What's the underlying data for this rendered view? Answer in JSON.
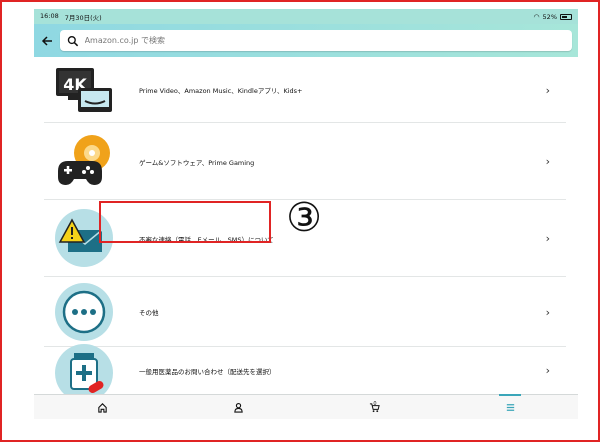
{
  "status_bar": {
    "time": "16:08",
    "date": "7月30日(火)",
    "battery": "52%"
  },
  "search": {
    "placeholder": "Amazon.co.jp で検索"
  },
  "menu": {
    "items": [
      {
        "label": "Prime Video、Amazon Music、Kindleアプリ、Kids+",
        "icon": "tv-4k-icon"
      },
      {
        "label": "ゲーム&ソフトウェア、Prime Gaming",
        "icon": "game-controller-disc-icon"
      },
      {
        "label": "不審な連絡（電話、Eメール、SMS）について",
        "icon": "warning-email-icon"
      },
      {
        "label": "その他",
        "icon": "more-dots-icon"
      },
      {
        "label": "一般用医薬品のお問い合わせ（配送先を選択）",
        "icon": "medicine-icon"
      }
    ]
  },
  "annotation": {
    "marker": "③"
  },
  "tabbar": {
    "tabs": [
      "home",
      "account",
      "cart",
      "menu"
    ],
    "cart_count": "0",
    "active": "menu"
  },
  "colors": {
    "accent": "#3aa6b9",
    "highlight": "#e02424",
    "header_bg": "#a6e2d9"
  }
}
